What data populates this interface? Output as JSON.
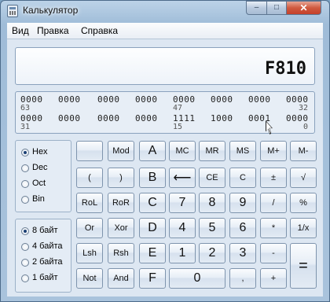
{
  "window": {
    "title": "Калькулятор",
    "minimize": "–",
    "maximize": "□",
    "close": "✕"
  },
  "menu": [
    "Вид",
    "Правка",
    "Справка"
  ],
  "display": {
    "value": "F810"
  },
  "bits": {
    "row1": [
      "0000",
      "0000",
      "0000",
      "0000",
      "0000",
      "0000",
      "0000",
      "0000"
    ],
    "row1_indices": [
      "63",
      "47",
      "32"
    ],
    "row2": [
      "0000",
      "0000",
      "0000",
      "0000",
      "1111",
      "1000",
      "0001",
      "0000"
    ],
    "row2_indices": [
      "31",
      "15",
      "0"
    ]
  },
  "base_modes": [
    {
      "label": "Hex",
      "selected": true
    },
    {
      "label": "Dec",
      "selected": false
    },
    {
      "label": "Oct",
      "selected": false
    },
    {
      "label": "Bin",
      "selected": false
    }
  ],
  "word_sizes": [
    {
      "label": "8 байт",
      "selected": true
    },
    {
      "label": "4 байта",
      "selected": false
    },
    {
      "label": "2 байта",
      "selected": false
    },
    {
      "label": "1 байт",
      "selected": false
    }
  ],
  "keys": {
    "blank": "",
    "mod": "Mod",
    "a": "A",
    "mc": "MC",
    "mr": "MR",
    "ms": "MS",
    "mplus": "M+",
    "mminus": "M-",
    "lparen": "(",
    "rparen": ")",
    "b": "B",
    "backspace": "⟵",
    "ce": "CE",
    "clear": "C",
    "plusminus": "±",
    "sqrt": "√",
    "rol": "RoL",
    "ror": "RoR",
    "c": "C",
    "seven": "7",
    "eight": "8",
    "nine": "9",
    "divide": "/",
    "percent": "%",
    "or": "Or",
    "xor": "Xor",
    "d": "D",
    "four": "4",
    "five": "5",
    "six": "6",
    "multiply": "*",
    "reciprocal": "1/x",
    "lsh": "Lsh",
    "rsh": "Rsh",
    "e": "E",
    "one": "1",
    "two": "2",
    "three": "3",
    "minus": "-",
    "equals": "=",
    "not": "Not",
    "and": "And",
    "f": "F",
    "zero": "0",
    "decimal": ",",
    "plus": "+"
  }
}
